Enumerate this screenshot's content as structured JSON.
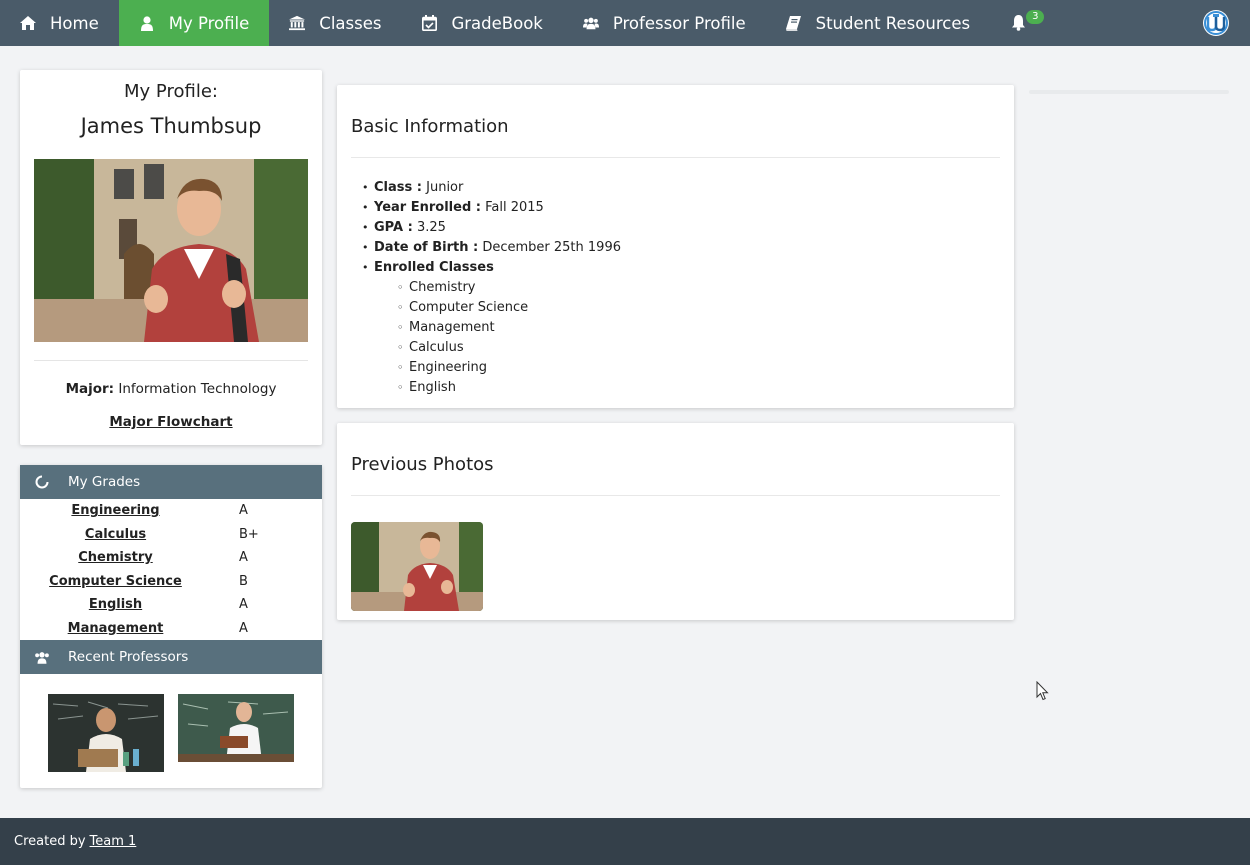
{
  "nav": {
    "items": [
      {
        "label": "Home",
        "icon": "home-icon"
      },
      {
        "label": "My Profile",
        "icon": "user-icon",
        "active": true
      },
      {
        "label": "Classes",
        "icon": "bank-icon"
      },
      {
        "label": "GradeBook",
        "icon": "calendar-check-icon"
      },
      {
        "label": "Professor Profile",
        "icon": "users-icon"
      },
      {
        "label": "Student Resources",
        "icon": "book-icon"
      }
    ],
    "notifications": {
      "count": "3",
      "icon": "bell-icon"
    },
    "logo": {
      "icon": "university-logo"
    }
  },
  "profile": {
    "heading": "My Profile:",
    "name": "James Thumbsup",
    "major_label": "Major:",
    "major_value": "Information Technology",
    "flowchart_link": "Major Flowchart"
  },
  "grades": {
    "title": "My Grades",
    "icon": "circle-notch-icon",
    "rows": [
      {
        "course": "Engineering",
        "grade": "A"
      },
      {
        "course": "Calculus",
        "grade": "B+"
      },
      {
        "course": "Chemistry",
        "grade": "A"
      },
      {
        "course": "Computer Science",
        "grade": "B"
      },
      {
        "course": "English",
        "grade": "A"
      },
      {
        "course": "Management",
        "grade": "A"
      }
    ]
  },
  "professors": {
    "title": "Recent Professors",
    "icon": "users-icon"
  },
  "basic_info": {
    "title": "Basic Information",
    "class_label": "Class :",
    "class_value": "Junior",
    "year_label": "Year Enrolled :",
    "year_value": "Fall 2015",
    "gpa_label": "GPA :",
    "gpa_value": "3.25",
    "dob_label": "Date of Birth :",
    "dob_value": "December 25th 1996",
    "classes_label": "Enrolled Classes",
    "classes": [
      "Chemistry",
      "Computer Science",
      "Management",
      "Calculus",
      "Engineering",
      "English"
    ]
  },
  "photos": {
    "title": "Previous Photos"
  },
  "footer": {
    "prefix": "Created by",
    "link": "Team 1"
  },
  "colors": {
    "nav_bg": "#4a5b69",
    "active": "#4caf50",
    "panel_header": "#58707d",
    "footer_bg": "#34404a"
  }
}
